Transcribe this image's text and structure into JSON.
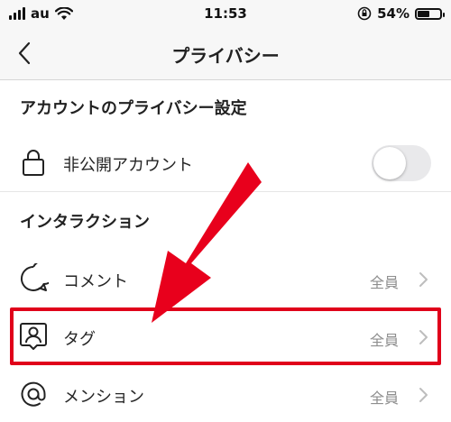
{
  "status_bar": {
    "carrier": "au",
    "time": "11:53",
    "battery_percent": "54%",
    "battery_level": 0.54
  },
  "nav": {
    "title": "プライバシー"
  },
  "sections": {
    "account": {
      "header": "アカウントのプライバシー設定",
      "private_label": "非公開アカウント",
      "private_on": false
    },
    "interactions": {
      "header": "インタラクション",
      "items": [
        {
          "label": "コメント",
          "value": "全員"
        },
        {
          "label": "タグ",
          "value": "全員"
        },
        {
          "label": "メンション",
          "value": "全員"
        }
      ]
    }
  },
  "colors": {
    "highlight": "#e0001a",
    "arrow": "#e8001c",
    "toggle_off": "#e9e9eb",
    "secondary_text": "#8e8e8e"
  },
  "icons": [
    "signal-icon",
    "wifi-icon",
    "rotation-lock-icon",
    "battery-icon",
    "back-chevron-icon",
    "lock-icon",
    "comment-bubble-icon",
    "tag-person-icon",
    "at-sign-icon",
    "chevron-right-icon",
    "red-arrow-annotation"
  ]
}
